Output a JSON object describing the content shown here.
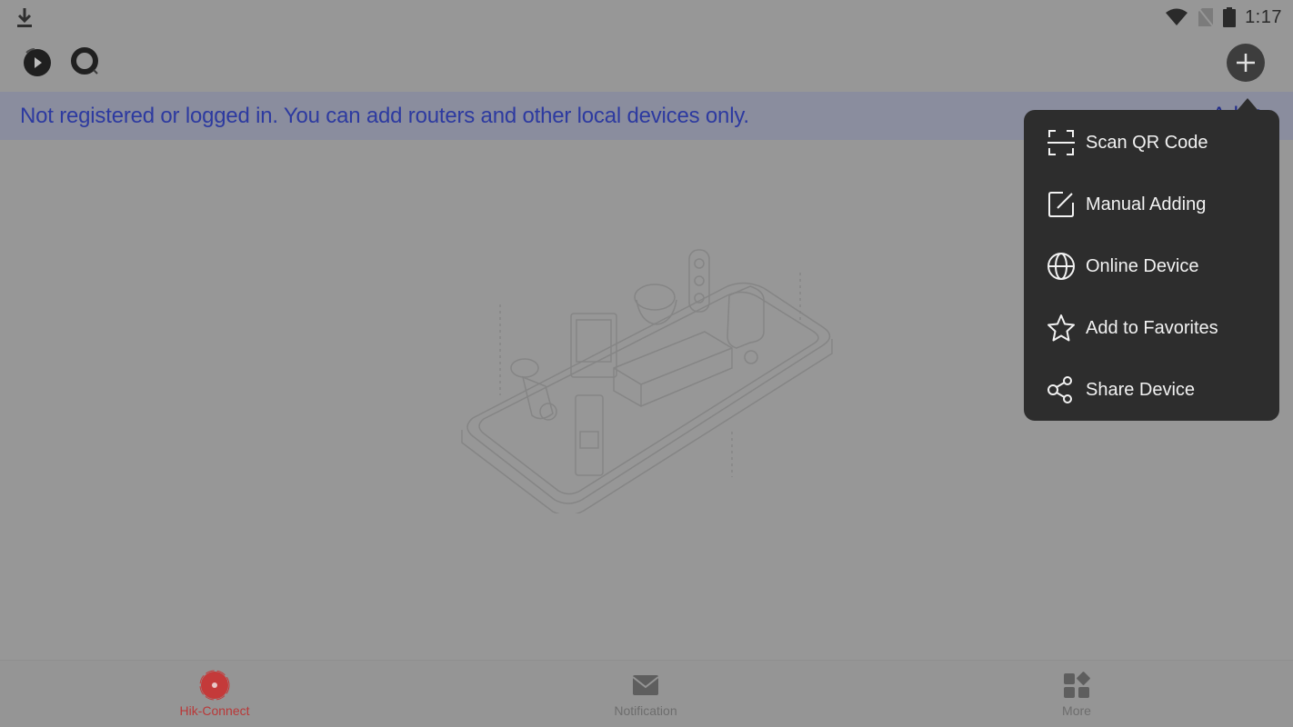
{
  "status_bar": {
    "time": "1:17",
    "icons": [
      "download-icon",
      "wifi-icon",
      "no-sim-icon",
      "battery-icon"
    ]
  },
  "toolbar": {
    "left_icons": [
      "playback-icon",
      "live-view-icon"
    ],
    "add_button_icon": "plus-icon"
  },
  "banner": {
    "message": "Not registered or logged in. You can add routers and other local devices only.",
    "action_label": "Add >"
  },
  "illustration": {
    "description": "empty-devices-illustration"
  },
  "add_menu": {
    "items": [
      {
        "label": "Scan QR Code",
        "icon": "scan-qr-icon"
      },
      {
        "label": "Manual Adding",
        "icon": "edit-icon"
      },
      {
        "label": "Online Device",
        "icon": "globe-icon"
      },
      {
        "label": "Add to Favorites",
        "icon": "star-icon"
      },
      {
        "label": "Share Device",
        "icon": "share-icon"
      }
    ]
  },
  "tabbar": {
    "tabs": [
      {
        "label": "Hik-Connect",
        "icon": "hik-connect-icon",
        "active": true
      },
      {
        "label": "Notification",
        "icon": "mail-icon",
        "active": false
      },
      {
        "label": "More",
        "icon": "grid-icon",
        "active": false
      }
    ]
  },
  "colors": {
    "accent_red": "#c43a3a",
    "banner_text": "#2d3aa0",
    "menu_bg": "#2d2d2d",
    "overlay_bg": "#979797"
  }
}
